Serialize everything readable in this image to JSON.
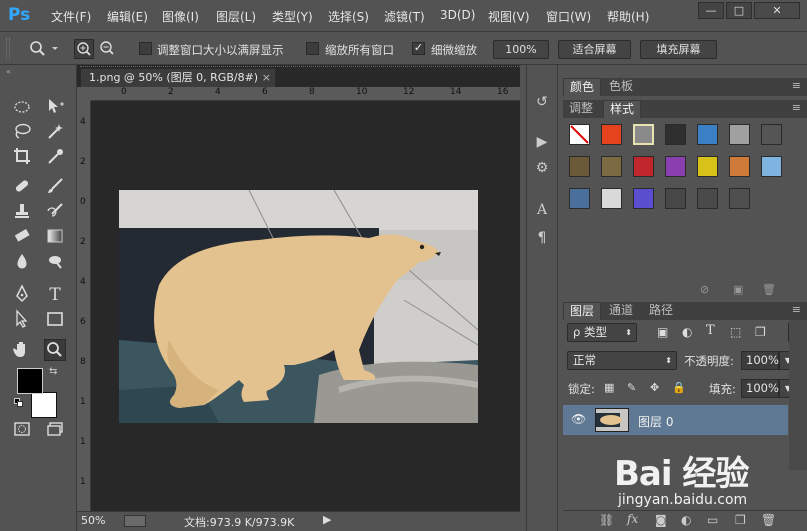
{
  "app": {
    "logo": "Ps"
  },
  "menu": [
    "文件(F)",
    "编辑(E)",
    "图像(I)",
    "图层(L)",
    "类型(Y)",
    "选择(S)",
    "滤镜(T)",
    "3D(D)",
    "视图(V)",
    "窗口(W)",
    "帮助(H)"
  ],
  "window_controls": {
    "minimize": "—",
    "maximize": "□",
    "close": "✕"
  },
  "options": {
    "tool_icon": "zoom-icon",
    "resize_windows_label": "调整窗口大小以满屏显示",
    "resize_windows_checked": false,
    "zoom_all_label": "缩放所有窗口",
    "zoom_all_checked": false,
    "scrubby_label": "细微缩放",
    "scrubby_checked": true,
    "percent_btn": "100%",
    "fit_btn": "适合屏幕",
    "fill_btn": "填充屏幕"
  },
  "document": {
    "tab_title": "1.png @ 50% (图层 0, RGB/8#)",
    "tab_close": "×",
    "ruler_h_ticks": [
      "0",
      "2",
      "4",
      "6",
      "8",
      "10",
      "12",
      "14",
      "16"
    ],
    "ruler_v_ticks": [
      "4",
      "2",
      "0",
      "2",
      "4",
      "6",
      "8",
      "1",
      "1",
      "1"
    ],
    "zoom": "50%",
    "doc_info": "文档:973.9 K/973.9K"
  },
  "panels": {
    "color_tabs": [
      "颜色",
      "色板"
    ],
    "adjust_tabs": [
      "调整",
      "样式"
    ],
    "active_adjust_tab": "样式",
    "style_colors": [
      "#ffffff",
      "#e5421e",
      "#8a8a8a",
      "#2f2f2f",
      "#3b7fc4",
      "#a0a0a0",
      "#555555",
      "#6b5a3a",
      "#7c6a43",
      "#c0272d",
      "#8a3fb0",
      "#d8c21a",
      "#d07a3a",
      "#7fb3e0",
      "#4a6f9b",
      "#d9d9d9",
      "#5b4fd0",
      "#474747",
      "#4a4a4a",
      "#4f4f4f"
    ],
    "layer_tabs": [
      "图层",
      "通道",
      "路径"
    ],
    "filter_kind": "ρ 类型",
    "blend_mode": "正常",
    "opacity_label": "不透明度:",
    "opacity_value": "100%",
    "lock_label": "锁定:",
    "fill_label": "填充:",
    "fill_value": "100%",
    "layer_name": "图层 0"
  },
  "watermark": {
    "brand": "Bai 经验",
    "url": "jingyan.baidu.com"
  }
}
